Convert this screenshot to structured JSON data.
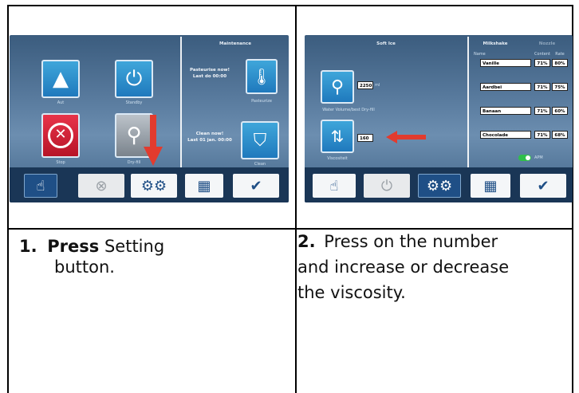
{
  "panel1": {
    "header_right": "Maintenance",
    "tiles": [
      {
        "label": "Aut",
        "icon": "ice-cream-icon"
      },
      {
        "label": "Standby",
        "icon": "power-icon"
      },
      {
        "label": "Stop",
        "icon": "stop-icon"
      },
      {
        "label": "Dry-fill",
        "icon": "whisk-icon"
      }
    ],
    "pasteurize_text": "Pasteurise now!",
    "pasteurize_sub": "Last do 00:00",
    "pasteurize_label": "Pasteurize",
    "clean_text": "Clean now!",
    "clean_sub": "Last 01 jan. 00:00",
    "clean_label": "Clean"
  },
  "panel2": {
    "header_left": "Soft Ice",
    "header_mid": "Milkshake",
    "header_right": "Nozzle",
    "col_name": "Name",
    "col_b": "Content",
    "col_c": "Rate",
    "whisk_value": "2250",
    "whisk_unit": "ml",
    "water_label": "Water Volume/best Dry-fill",
    "viscosity_value": "160",
    "viscosity_label": "Viscositeit",
    "flavors": [
      {
        "name": "Vanille",
        "a": "71%",
        "b": "80%"
      },
      {
        "name": "Aardbei",
        "a": "71%",
        "b": "75%"
      },
      {
        "name": "Banaan",
        "a": "71%",
        "b": "60%"
      },
      {
        "name": "Chocolade",
        "a": "71%",
        "b": "68%"
      }
    ],
    "toggle_label": "APM"
  },
  "captions": {
    "step1_num": "1.",
    "step1_bold": "Press",
    "step1_rest": "Setting",
    "step1_line2": "button.",
    "step2_num": "2.",
    "step2_line1": "Press on the number",
    "step2_line2": "and increase or decrease",
    "step2_line3": "the viscosity."
  },
  "colors": {
    "accent": "#1f4f86",
    "stop": "#d42036",
    "arrow": "#e23b2e",
    "toggle": "#2fbf4a"
  }
}
